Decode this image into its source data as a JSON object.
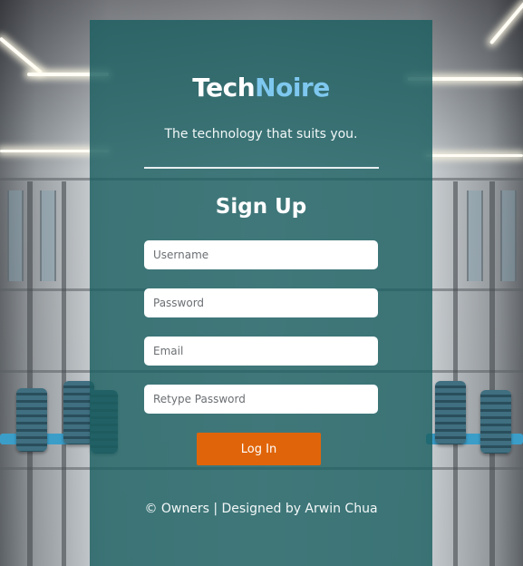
{
  "brand": {
    "name_part1": "Tech",
    "name_part2": "Noire",
    "tagline": "The technology that suits you."
  },
  "form": {
    "title": "Sign Up",
    "fields": {
      "username_placeholder": "Username",
      "password_placeholder": "Password",
      "email_placeholder": "Email",
      "retype_password_placeholder": "Retype Password"
    },
    "submit_label": "Log In"
  },
  "footer": {
    "text": "© Owners | Designed by Arwin Chua"
  },
  "colors": {
    "panel": "#1b5e60",
    "brand_accent": "#7ec8f0",
    "button": "#e0650a"
  }
}
